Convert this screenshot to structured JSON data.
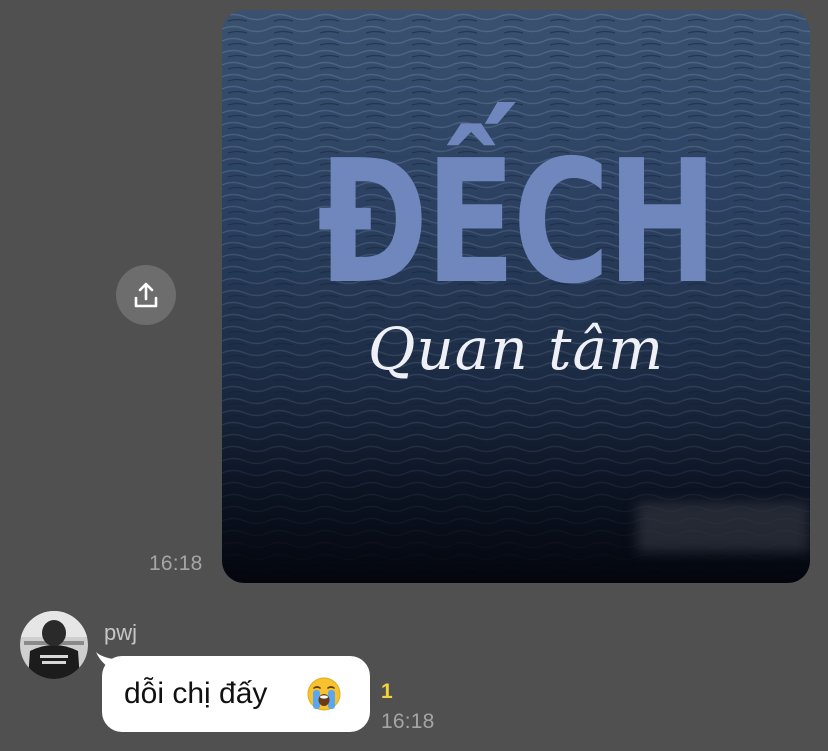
{
  "colors": {
    "background": "#505050",
    "share_button": "#6d6d6d",
    "timestamp": "#a5a5a5",
    "unread_badge": "#f2d33a",
    "bubble": "#ffffff",
    "image_title": "#6f87bd",
    "image_subtitle": "#eef0f5"
  },
  "icons": {
    "share": "share-upload-icon",
    "emoji": "loudly-crying-face-emoji"
  },
  "outgoing_message": {
    "image": {
      "title": "ĐẾCH",
      "subtitle": "Quan tâm"
    },
    "time": "16:18"
  },
  "incoming_message": {
    "sender_name": "pwj",
    "text": "dỗi chị đấy",
    "unread_count": "1",
    "time": "16:18"
  }
}
